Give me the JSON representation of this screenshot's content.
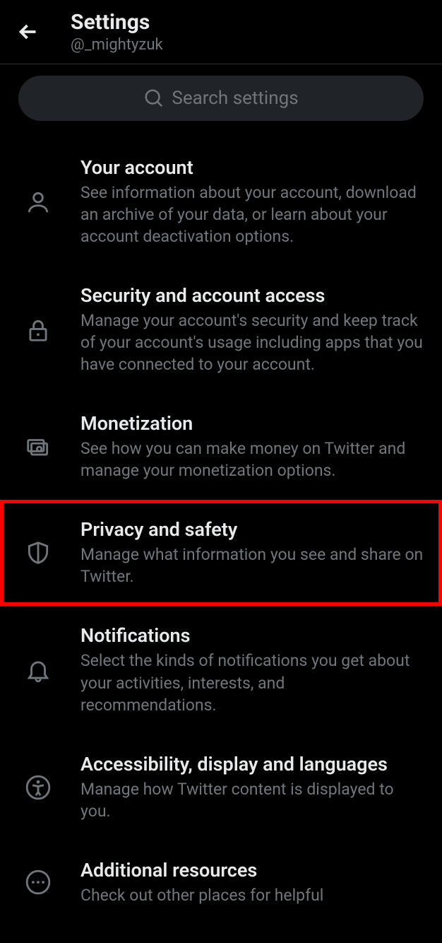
{
  "header": {
    "title": "Settings",
    "subtitle": "@_mightyzuk"
  },
  "search": {
    "placeholder": "Search settings"
  },
  "items": [
    {
      "title": "Your account",
      "desc": "See information about your account, download an archive of your data, or learn about your account deactivation options."
    },
    {
      "title": "Security and account access",
      "desc": "Manage your account's security and keep track of your account's usage including apps that you have connected to your account."
    },
    {
      "title": "Monetization",
      "desc": "See how you can make money on Twitter and manage your monetization options."
    },
    {
      "title": "Privacy and safety",
      "desc": "Manage what information you see and share on Twitter."
    },
    {
      "title": "Notifications",
      "desc": "Select the kinds of notifications you get about your activities, interests, and recommendations."
    },
    {
      "title": "Accessibility, display and languages",
      "desc": "Manage how Twitter content is displayed to you."
    },
    {
      "title": "Additional resources",
      "desc": "Check out other places for helpful"
    }
  ]
}
